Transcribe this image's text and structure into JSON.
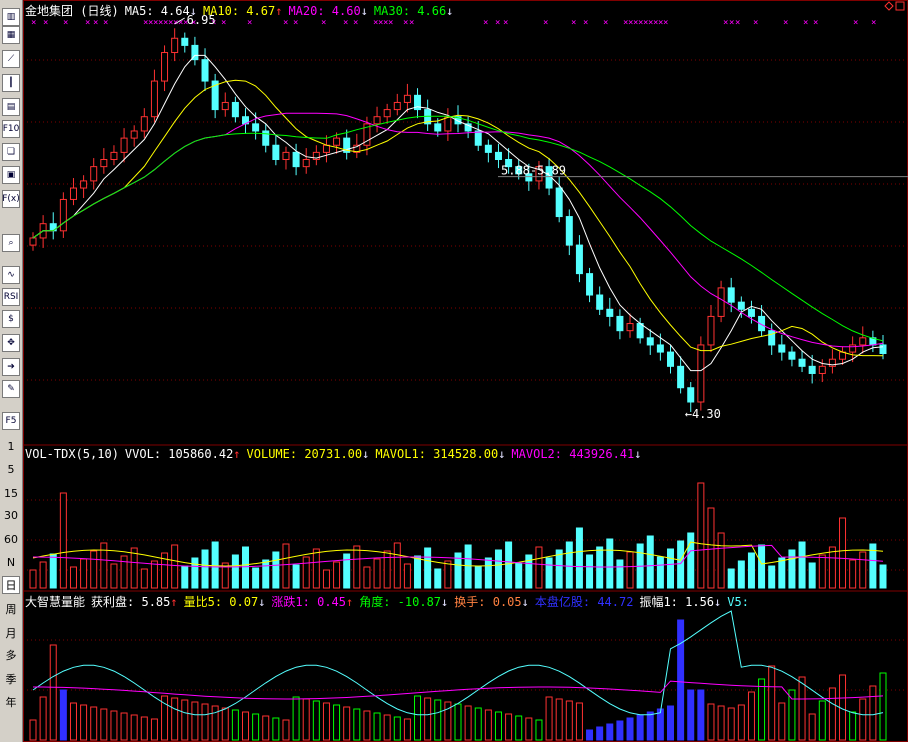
{
  "toolbar": {
    "icons": [
      "kline-icon",
      "grid-icon",
      "line-chart-icon",
      "candle-icon",
      "window-icon",
      "f10-icon",
      "bookmark-icon",
      "notes-icon",
      "formula-icon",
      "search-icon",
      "wave-icon",
      "rsi-icon",
      "dollar-icon",
      "move-icon",
      "export-icon",
      "pencil-icon",
      "f5-icon"
    ],
    "icon_texts": {
      "f10-icon": "F10",
      "rsi-icon": "RSI",
      "f5-icon": "F5",
      "formula-icon": "F(x)"
    },
    "periods": [
      "1",
      "5",
      "15",
      "30",
      "60",
      "N",
      "日",
      "周",
      "月",
      "多",
      "季",
      "年"
    ],
    "active_period": "日"
  },
  "main_panel": {
    "title": "金地集团 (日线)",
    "ma5_label": "MA5: 4.64",
    "ma5_arrow": "↓",
    "ma10_label": "MA10: 4.67",
    "ma10_arrow": "↑",
    "ma20_label": "MA20: 4.60",
    "ma20_arrow": "↓",
    "ma30_label": "MA30: 4.66",
    "ma30_arrow": "↓",
    "high_label": "6.95",
    "low_label": "4.30",
    "range_label": "5.88-5.89",
    "colors": {
      "ma5": "#ffffff",
      "ma10": "#ffff00",
      "ma20": "#ff00ff",
      "ma30": "#00ff00",
      "up": "#ff3232",
      "down": "#54ffff",
      "grid": "#800000"
    }
  },
  "vol_panel": {
    "name": "VOL-TDX(5,10)",
    "vvol": "VVOL: 105860.42",
    "vvol_arrow": "↑",
    "volume": "VOLUME: 20731.00",
    "volume_arrow": "↓",
    "mavol1": "MAVOL1: 314528.00",
    "mavol1_arrow": "↓",
    "mavol2": "MAVOL2: 443926.41",
    "mavol2_arrow": "↓"
  },
  "energy_panel": {
    "name": "大智慧量能",
    "profit": "获利盘: 5.85",
    "profit_arrow": "↑",
    "ratio": "量比5: 0.07",
    "ratio_arrow": "↓",
    "change": "涨跌1: 0.45",
    "change_arrow": "↑",
    "angle": "角度: -10.87",
    "angle_arrow": "↓",
    "turnover": "换手: 0.05",
    "turnover_arrow": "↓",
    "capital": "本盘亿股: 44.72",
    "amplitude": "振幅1: 1.56",
    "amplitude_arrow": "↓",
    "v5": "V5:"
  },
  "chart_data": {
    "type": "candlestick",
    "closes": [
      5.45,
      5.55,
      5.5,
      5.72,
      5.8,
      5.85,
      5.95,
      6.0,
      6.05,
      6.15,
      6.2,
      6.3,
      6.55,
      6.75,
      6.85,
      6.8,
      6.7,
      6.55,
      6.35,
      6.4,
      6.3,
      6.25,
      6.2,
      6.1,
      6.0,
      6.05,
      5.95,
      6.0,
      6.05,
      6.1,
      6.15,
      6.05,
      6.1,
      6.25,
      6.3,
      6.35,
      6.4,
      6.45,
      6.35,
      6.25,
      6.2,
      6.3,
      6.25,
      6.2,
      6.1,
      6.05,
      6.0,
      5.95,
      5.9,
      5.85,
      5.95,
      5.8,
      5.6,
      5.4,
      5.2,
      5.05,
      4.95,
      4.9,
      4.8,
      4.85,
      4.75,
      4.7,
      4.65,
      4.55,
      4.4,
      4.3,
      4.7,
      4.9,
      5.1,
      5.0,
      4.95,
      4.9,
      4.8,
      4.7,
      4.65,
      4.6,
      4.55,
      4.5,
      4.55,
      4.6,
      4.65,
      4.7,
      4.75,
      4.7,
      4.64
    ]
  }
}
